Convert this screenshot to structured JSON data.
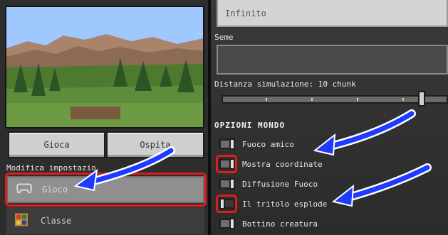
{
  "left_panel": {
    "play_button": "Gioca",
    "host_button": "Ospita",
    "modify_settings_label": "Modifica impostazio",
    "categories": [
      {
        "label": "Gioco",
        "icon": "controller-icon",
        "selected": true
      },
      {
        "label": "Classe",
        "icon": "class-icon",
        "selected": false
      }
    ]
  },
  "right_panel": {
    "world_type_value": "Infinito",
    "seed_label": "Seme",
    "seed_value": "",
    "simulation_distance_label": "Distanza simulazione: 10 chunk",
    "simulation_distance_chunks": 10,
    "world_options_title": "OPZIONI MONDO",
    "options": [
      {
        "label": "Fuoco amico",
        "on": true
      },
      {
        "label": "Mostra coordinate",
        "on": true
      },
      {
        "label": "Diffusione Fuoco",
        "on": true
      },
      {
        "label": "Il tritolo esplode",
        "on": false
      },
      {
        "label": "Bottino creatura",
        "on": true
      }
    ]
  },
  "annotations": {
    "highlight_color": "#e21b1b",
    "arrow_color": "#1f3bff"
  }
}
